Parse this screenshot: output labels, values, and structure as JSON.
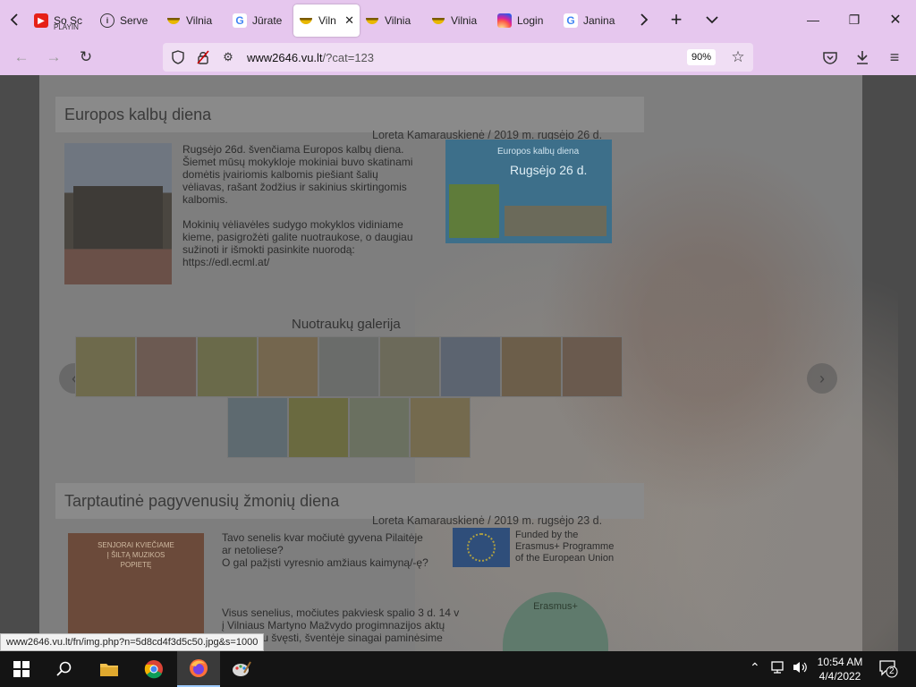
{
  "browser": {
    "tabs": [
      {
        "label": "So Sc",
        "sub": "PLAYIN",
        "icon": "youtube-icon"
      },
      {
        "label": "Serve",
        "icon": "info-icon"
      },
      {
        "label": "Vilnia",
        "icon": "vu-icon"
      },
      {
        "label": "Jūrate",
        "icon": "google-icon"
      },
      {
        "label": "Viln",
        "icon": "vu-icon",
        "active": true
      },
      {
        "label": "Vilnia",
        "icon": "vu-icon"
      },
      {
        "label": "Vilnia",
        "icon": "vu-icon"
      },
      {
        "label": "Login",
        "icon": "instagram-icon"
      },
      {
        "label": "Janina",
        "icon": "google-icon"
      }
    ],
    "url_domain": "www2646.vu.lt",
    "url_path": "/?cat=123",
    "zoom": "90%"
  },
  "page": {
    "article1": {
      "title": "Europos kalbų diena",
      "byline": "Loreta Kamarauskienė / 2019 m. rugsėjo 26 d.",
      "lines": [
        "Rugsėjo 26d. švenčiama Europos kalbų diena.",
        "Šiemet mūsų mokykloje mokiniai buvo skatinami",
        "domėtis įvairiomis kalbomis piešiant šalių",
        "vėliavas, rašant žodžius ir sakinius skirtingomis",
        "kalbomis.",
        "",
        "Mokinių vėliavėles sudygo mokyklos vidiniame",
        "kieme, pasigrožėti galite nuotraukose, o daugiau",
        "sužinoti ir išmokti pasinkite nuorodą:",
        " https://edl.ecml.at/"
      ],
      "poster_title": "Europos kalbų diena",
      "poster_date": "Rugsėjo 26 d."
    },
    "gallery_title": "Nuotraukų galerija",
    "article2": {
      "title": "Tarptautinė pagyvenusių žmonių diena",
      "byline": "Loreta Kamarauskienė / 2019 m. rugsėjo 23 d.",
      "lines": [
        "Tavo senelis kvar močiutė gyvena Pilaitėje",
        "ar netoliese?",
        "O gal pažįsti vyresnio amžiaus kaimyną/-ę?",
        "",
        "",
        "Visus senelius, močiutes pakviesk spalio 3 d. 14 v",
        "į Vilniaus Martyno Mažvydo progimnazijos aktų",
        "salę kartu švęsti, šventėje sinagai paminėsime"
      ],
      "eu_text": [
        "Funded by the",
        "Erasmus+ Programme",
        "of the European Union"
      ],
      "poster_text": [
        "SENJORAI KVIEČIAME",
        "Į ŠILTĄ MUZIKOS",
        "POPIETĘ"
      ],
      "badge": "Erasmus+"
    }
  },
  "status_link": "www2646.vu.lt/fn/img.php?n=5d8cd4f3d5c50.jpg&s=1000",
  "taskbar": {
    "time": "10:54 AM",
    "date": "4/4/2022",
    "notifications": "2"
  },
  "colors": {
    "tabbar": "#e6c7ee",
    "page_bg": "#7e7e7e",
    "taskbar": "#141414"
  }
}
